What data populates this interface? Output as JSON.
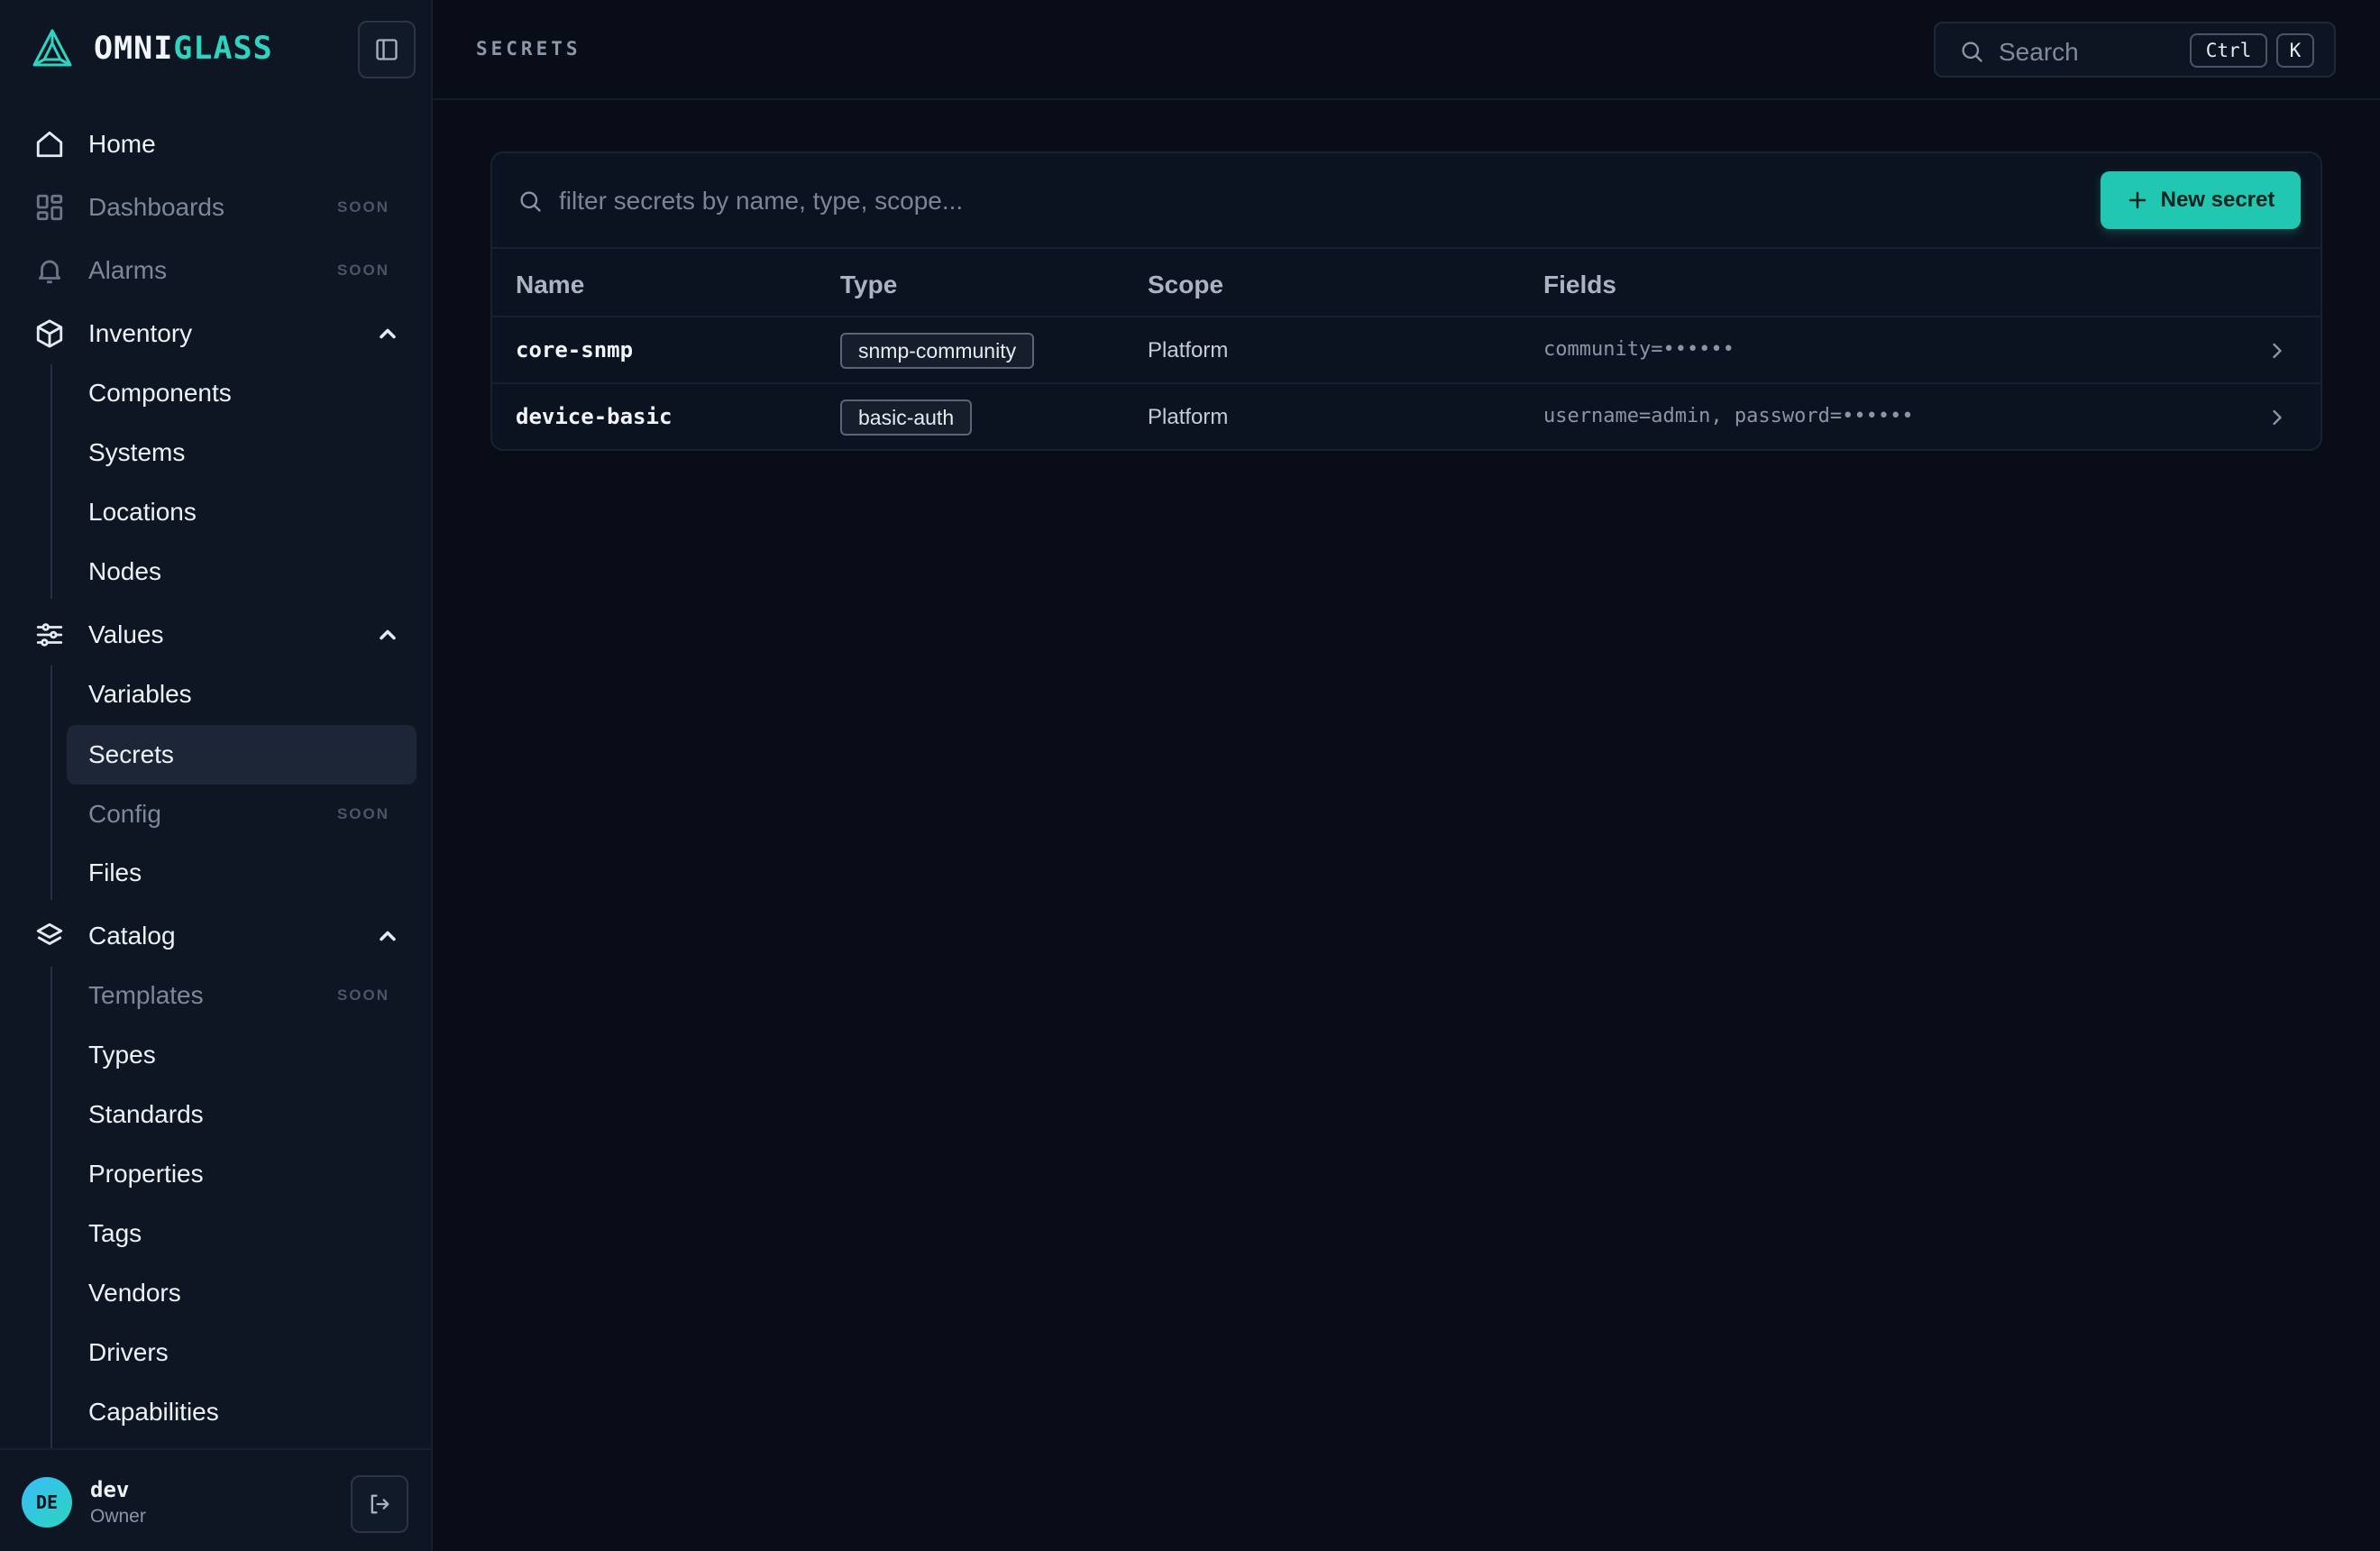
{
  "brand": {
    "name_a": "OMNI",
    "name_b": "GLASS",
    "accent": "#2dd4bf"
  },
  "sidebar": {
    "soon_label": "SOON",
    "home": "Home",
    "dashboards": "Dashboards",
    "alarms": "Alarms",
    "inventory": {
      "label": "Inventory",
      "items": [
        "Components",
        "Systems",
        "Locations",
        "Nodes"
      ]
    },
    "values": {
      "label": "Values",
      "items": [
        "Variables",
        "Secrets",
        "Config",
        "Files"
      ],
      "active": "Secrets"
    },
    "catalog": {
      "label": "Catalog",
      "items": [
        "Templates",
        "Types",
        "Standards",
        "Properties",
        "Tags",
        "Vendors",
        "Drivers",
        "Capabilities"
      ]
    }
  },
  "user": {
    "initials": "DE",
    "name": "dev",
    "role": "Owner"
  },
  "header": {
    "title": "SECRETS",
    "search_placeholder": "Search",
    "shortcut_mod": "Ctrl",
    "shortcut_key": "K"
  },
  "secrets": {
    "filter_placeholder": "filter secrets by name, type, scope...",
    "new_button": "New secret",
    "columns": {
      "name": "Name",
      "type": "Type",
      "scope": "Scope",
      "fields": "Fields"
    },
    "rows": [
      {
        "name": "core-snmp",
        "type": "snmp-community",
        "scope": "Platform",
        "fields": "community=••••••"
      },
      {
        "name": "device-basic",
        "type": "basic-auth",
        "scope": "Platform",
        "fields": "username=admin, password=••••••"
      }
    ]
  }
}
